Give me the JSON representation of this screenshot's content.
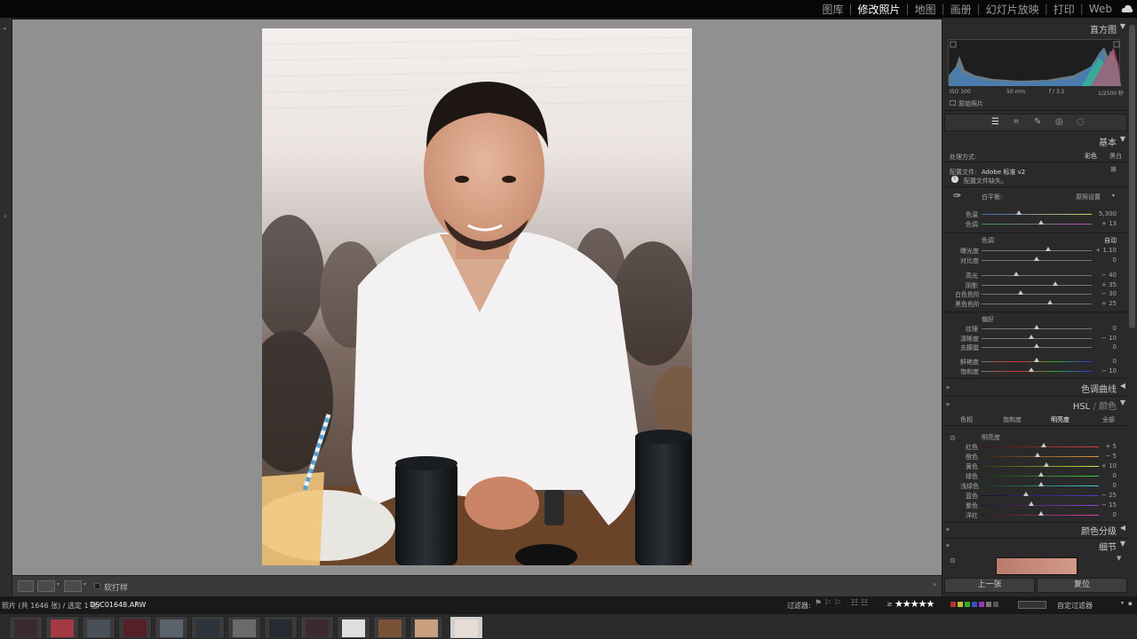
{
  "modules": [
    "图库",
    "修改照片",
    "地图",
    "画册",
    "幻灯片放映",
    "打印",
    "Web"
  ],
  "active_module": "修改照片",
  "histogram": {
    "title": "直方图",
    "iso": "ISO 100",
    "focal": "50 mm",
    "aperture": "f / 3.2",
    "shutter": "1/2500 秒",
    "original_label": "原始照片"
  },
  "basic": {
    "title": "基本",
    "treatment_label": "处理方式:",
    "color": "彩色",
    "bw": "黑白",
    "profile_label": "配置文件:",
    "profile_value": "Adobe 标准 v2",
    "profile_missing": "配置文件缺失。",
    "wb_label": "白平衡:",
    "wb_value": "原照设置",
    "tone_label": "色调",
    "auto": "自动",
    "presence_label": "偏好",
    "sliders": [
      {
        "label": "色温",
        "value": "5,300"
      },
      {
        "label": "色调",
        "value": "+ 13"
      },
      {
        "label": "曝光度",
        "value": "+ 1.10"
      },
      {
        "label": "对比度",
        "value": "0"
      },
      {
        "label": "高光",
        "value": "− 40"
      },
      {
        "label": "阴影",
        "value": "+ 35"
      },
      {
        "label": "白色色阶",
        "value": "− 30"
      },
      {
        "label": "黑色色阶",
        "value": "+ 25"
      },
      {
        "label": "纹理",
        "value": "0"
      },
      {
        "label": "清晰度",
        "value": "− 10"
      },
      {
        "label": "去朦胧",
        "value": "0"
      },
      {
        "label": "鲜艳度",
        "value": "0"
      },
      {
        "label": "饱和度",
        "value": "− 10"
      }
    ]
  },
  "tone_curve": {
    "title": "色调曲线"
  },
  "hsl": {
    "title_hsl": "HSL",
    "title_color": "颜色",
    "tabs": [
      "色相",
      "饱和度",
      "明亮度",
      "全部"
    ],
    "active_tab": "明亮度",
    "group_label": "明亮度",
    "sliders": [
      {
        "label": "红色",
        "value": "+ 5"
      },
      {
        "label": "橙色",
        "value": "− 5"
      },
      {
        "label": "黄色",
        "value": "+ 10"
      },
      {
        "label": "绿色",
        "value": "0"
      },
      {
        "label": "浅绿色",
        "value": "0"
      },
      {
        "label": "蓝色",
        "value": "− 25"
      },
      {
        "label": "紫色",
        "value": "− 15"
      },
      {
        "label": "洋红",
        "value": "0"
      }
    ]
  },
  "split_toning": {
    "title": "颜色分级"
  },
  "detail": {
    "title": "细节"
  },
  "nav_buttons": {
    "prev": "上一张",
    "reset": "复位"
  },
  "toolbar": {
    "soft_proof": "软打样"
  },
  "status": {
    "path": "照片 (共 1646 张) / 选定 1 张/",
    "filename": "DSC01648.ARW",
    "filter_label": "过滤器:",
    "stars": "★★★★★",
    "custom_filter": "自定过滤器"
  },
  "colors": {
    "accent_active": "#ffffff",
    "panel_bg": "#2a2a2a",
    "center_bg": "#909090"
  }
}
